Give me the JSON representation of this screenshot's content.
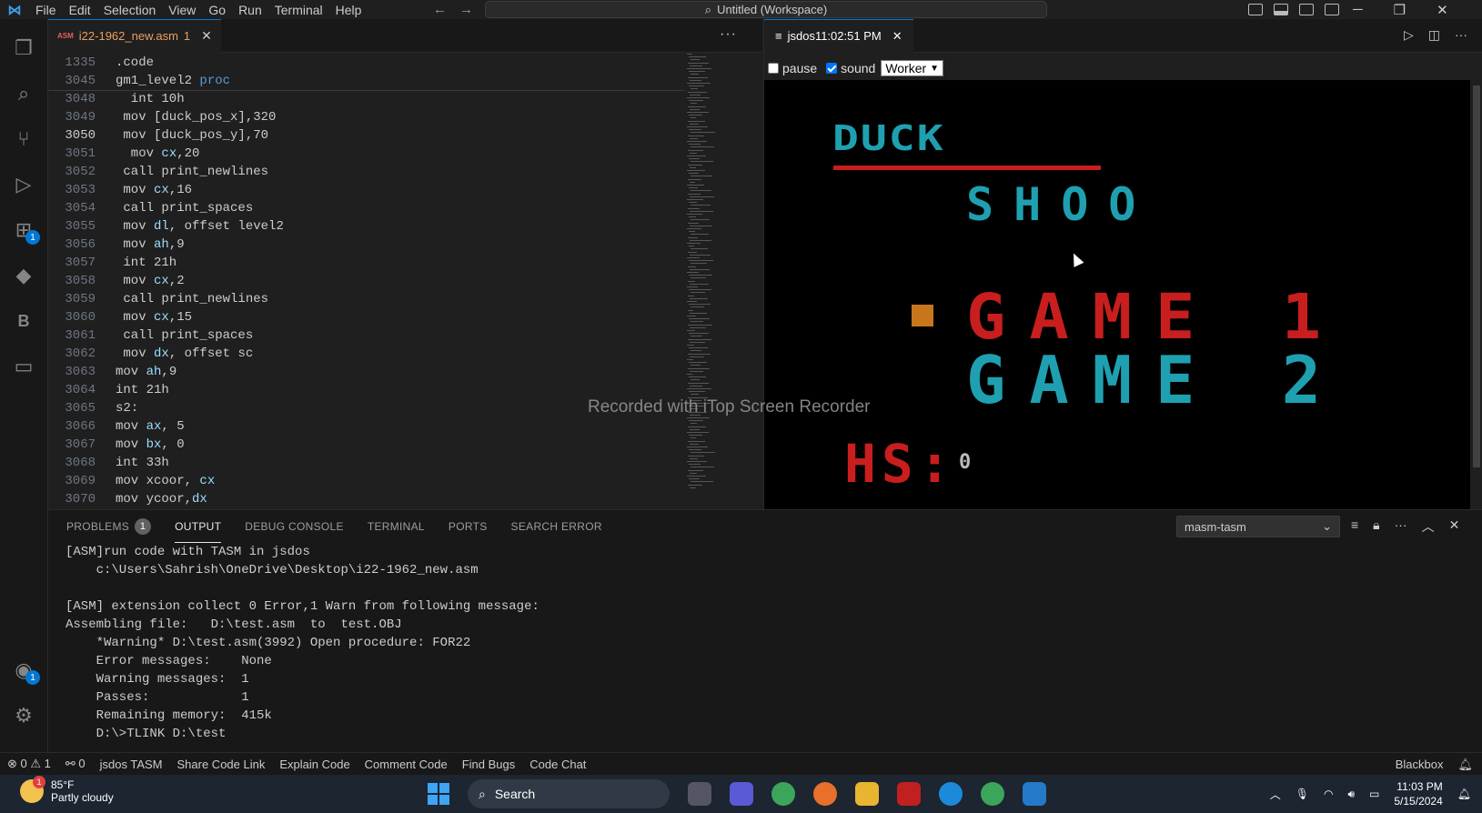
{
  "titlebar": {
    "menu": [
      "File",
      "Edit",
      "Selection",
      "View",
      "Go",
      "Run",
      "Terminal",
      "Help"
    ],
    "search": "Untitled (Workspace)"
  },
  "editor": {
    "tab": {
      "icon": "ASM",
      "label": "i22-1962_new.asm",
      "count": "1"
    },
    "lines": [
      {
        "n": "1335",
        "t": ".code"
      },
      {
        "n": "3045",
        "t": "gm1_level2 proc"
      },
      {
        "n": "3048",
        "t": "  int 10h"
      },
      {
        "n": "3049",
        "t": " mov [duck_pos_x],320"
      },
      {
        "n": "3050",
        "t": " mov [duck_pos_y],70"
      },
      {
        "n": "3051",
        "t": "  mov cx,20"
      },
      {
        "n": "3052",
        "t": " call print_newlines"
      },
      {
        "n": "3053",
        "t": " mov cx,16"
      },
      {
        "n": "3054",
        "t": " call print_spaces"
      },
      {
        "n": "3055",
        "t": " mov dl, offset level2"
      },
      {
        "n": "3056",
        "t": " mov ah,9"
      },
      {
        "n": "3057",
        "t": " int 21h"
      },
      {
        "n": "3058",
        "t": " mov cx,2"
      },
      {
        "n": "3059",
        "t": " call print_newlines"
      },
      {
        "n": "3060",
        "t": " mov cx,15"
      },
      {
        "n": "3061",
        "t": " call print_spaces"
      },
      {
        "n": "3062",
        "t": " mov dx, offset sc"
      },
      {
        "n": "3063",
        "t": "mov ah,9"
      },
      {
        "n": "3064",
        "t": "int 21h"
      },
      {
        "n": "3065",
        "t": "s2:"
      },
      {
        "n": "3066",
        "t": "mov ax, 5"
      },
      {
        "n": "3067",
        "t": "mov bx, 0"
      },
      {
        "n": "3068",
        "t": "int 33h"
      },
      {
        "n": "3069",
        "t": "mov xcoor, cx"
      },
      {
        "n": "3070",
        "t": "mov ycoor,dx"
      }
    ],
    "active_line": "3050"
  },
  "preview": {
    "tab_label": "jsdos11:02:51 PM",
    "pause_label": "pause",
    "sound_label": "sound",
    "sound_checked": true,
    "pause_checked": false,
    "worker_value": "Worker",
    "game": {
      "title": "DUCK",
      "subtitle": "SHOO",
      "option1": "GAME 1",
      "option2": "GAME 2",
      "hs_label": "HS:",
      "hs_value": "0"
    }
  },
  "watermark": "Recorded with iTop Screen Recorder",
  "panel": {
    "tabs": [
      "PROBLEMS",
      "OUTPUT",
      "DEBUG CONSOLE",
      "TERMINAL",
      "PORTS",
      "SEARCH ERROR"
    ],
    "problems_count": "1",
    "active_tab": "OUTPUT",
    "output_source": "masm-tasm",
    "output_lines": [
      "[ASM]run code with TASM in jsdos",
      "    c:\\Users\\Sahrish\\OneDrive\\Desktop\\i22-1962_new.asm",
      "",
      "[ASM] extension collect 0 Error,1 Warn from following message:",
      "Assembling file:   D:\\test.asm  to  test.OBJ",
      "    *Warning* D:\\test.asm(3992) Open procedure: FOR22",
      "    Error messages:    None",
      "    Warning messages:  1",
      "    Passes:            1",
      "    Remaining memory:  415k",
      "    D:\\>TLINK D:\\test"
    ]
  },
  "statusbar": {
    "errors": "0",
    "warnings": "1",
    "ports": "0",
    "items": [
      "jsdos TASM",
      "Share Code Link",
      "Explain Code",
      "Comment Code",
      "Find Bugs",
      "Code Chat"
    ],
    "right": "Blackbox"
  },
  "taskbar": {
    "temp": "85°F",
    "weather": "Partly cloudy",
    "weather_badge": "1",
    "search": "Search",
    "time": "11:03 PM",
    "date": "5/15/2024"
  }
}
